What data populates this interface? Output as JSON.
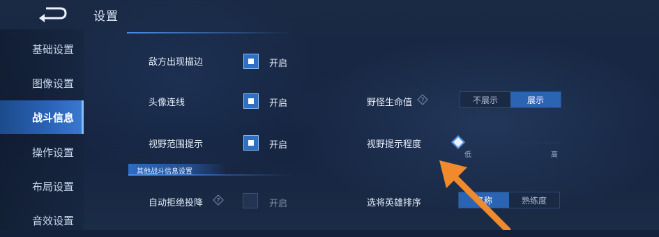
{
  "header": {
    "title": "设置"
  },
  "sidebar": {
    "items": [
      {
        "label": "基础设置"
      },
      {
        "label": "图像设置"
      },
      {
        "label": "战斗信息"
      },
      {
        "label": "操作设置"
      },
      {
        "label": "布局设置"
      },
      {
        "label": "音效设置"
      }
    ]
  },
  "sections": {
    "other_battle_info": "其他战斗信息设置"
  },
  "left_rows": [
    {
      "label": "敌方出现描边",
      "toggle": "开启",
      "checked": true
    },
    {
      "label": "头像连线",
      "toggle": "开启",
      "checked": true
    },
    {
      "label": "视野范围提示",
      "toggle": "开启",
      "checked": true
    },
    {
      "label": "自动拒绝投降",
      "toggle": "开启",
      "checked": false
    }
  ],
  "monster_hp": {
    "label": "野怪生命值",
    "options": [
      "不展示",
      "展示"
    ],
    "selected": "展示"
  },
  "vision_hint": {
    "label": "视野提示程度",
    "min_label": "低",
    "max_label": "高",
    "level": 0
  },
  "hero_sort": {
    "label": "选将英雄排序",
    "options": [
      "名称",
      "熟练度"
    ],
    "selected": "名称"
  },
  "colors": {
    "accent": "#2c64b4",
    "annotation_arrow": "#f08a2c"
  }
}
